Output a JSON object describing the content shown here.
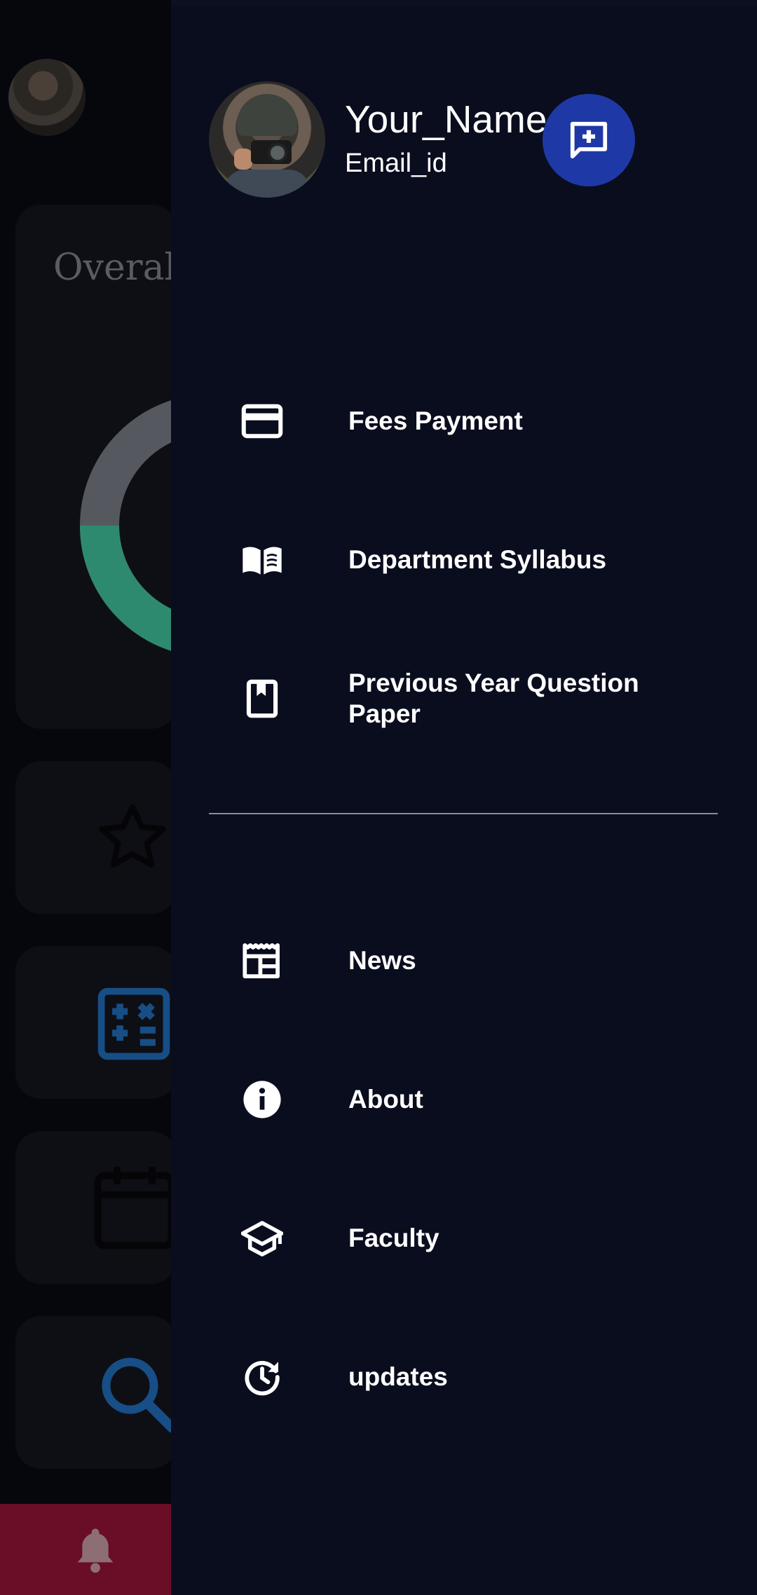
{
  "background": {
    "card_title": "Overal",
    "colors": {
      "accent_green": "#2e8a6e",
      "accent_blue": "#174e86",
      "bell_bar": "#6a0d27"
    }
  },
  "drawer": {
    "user_name": "Your_Name",
    "user_email": "Email_id",
    "fab_icon": "add-comment-icon",
    "fab_color": "#1e39a6",
    "primary_items": [
      {
        "label": "Fees Payment",
        "icon": "credit-card-icon"
      },
      {
        "label": "Department Syllabus",
        "icon": "menu-book-icon"
      },
      {
        "label": "Previous Year Question Paper",
        "icon": "bookmark-book-icon"
      }
    ],
    "secondary_items": [
      {
        "label": "News",
        "icon": "newspaper-icon"
      },
      {
        "label": "About",
        "icon": "info-icon"
      },
      {
        "label": "Faculty",
        "icon": "graduation-cap-icon"
      },
      {
        "label": "updates",
        "icon": "update-clock-icon"
      }
    ]
  }
}
